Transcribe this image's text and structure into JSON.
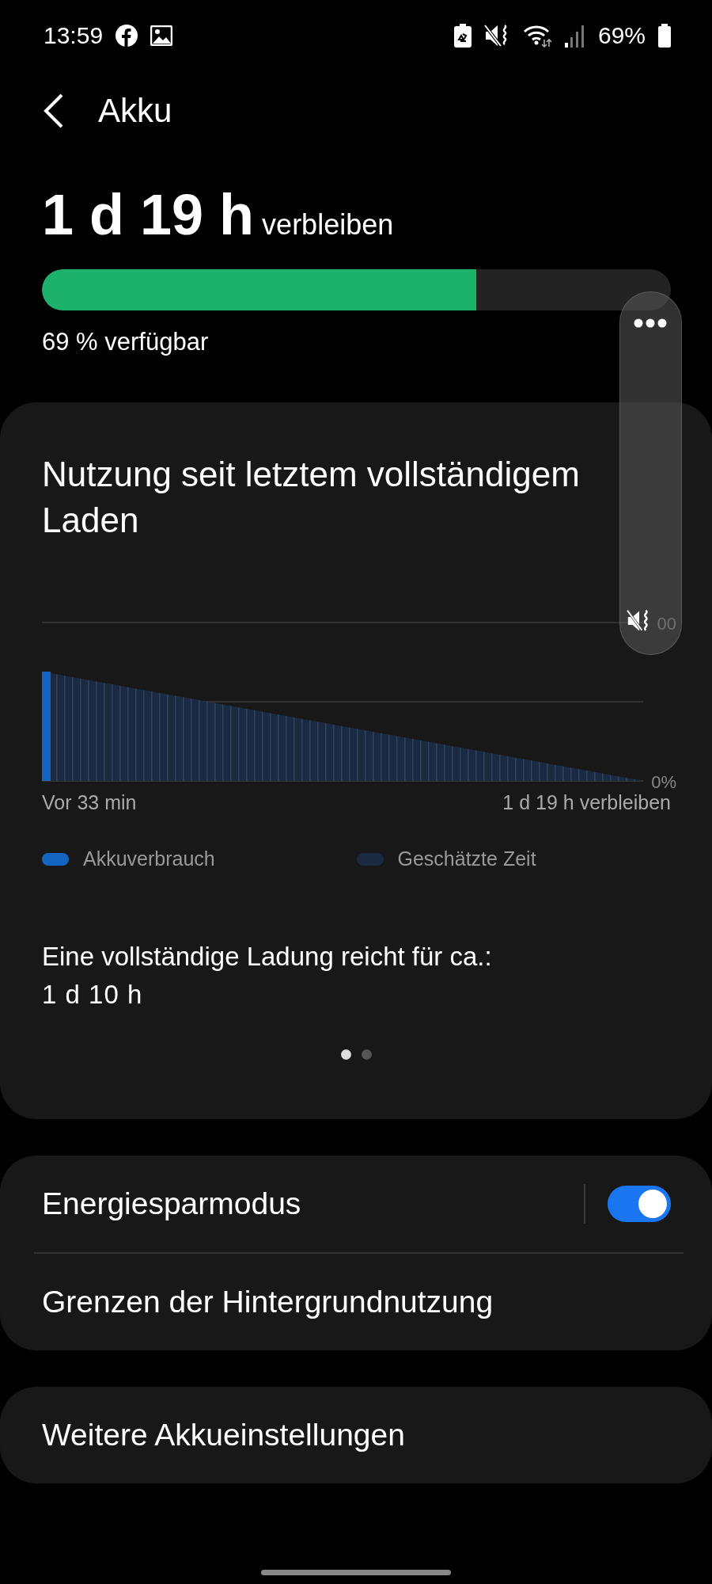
{
  "status_bar": {
    "time": "13:59",
    "battery": "69%"
  },
  "header": {
    "title": "Akku"
  },
  "summary": {
    "remaining": "1 d 19 h",
    "remaining_suffix": "verbleiben",
    "level": 0.69,
    "available": "69 % verfügbar"
  },
  "usage_card": {
    "title": "Nutzung seit letztem vollständigem Laden",
    "chart": {
      "y_labels": [
        "00",
        "0%"
      ],
      "x_labels": [
        "Vor 33 min",
        "1 d 19 h verbleiben"
      ],
      "legend": [
        {
          "label": "Akkuverbrauch",
          "color": "#1565c0"
        },
        {
          "label": "Geschätzte Zeit",
          "color": "#1b2a40"
        }
      ]
    },
    "full_charge_label": "Eine vollständige Ladung reicht für ca.:",
    "full_charge_value": "1 d 10 h",
    "pages": [
      {
        "selected": true
      },
      {
        "selected": false
      }
    ]
  },
  "settings": [
    {
      "label": "Energiesparmodus",
      "kind": "toggle",
      "on": true
    },
    {
      "label": "Grenzen der Hintergrundnutzung",
      "kind": "link"
    }
  ],
  "more_settings": {
    "label": "Weitere Akkueinstellungen"
  },
  "volume_panel": {
    "muted": true
  }
}
